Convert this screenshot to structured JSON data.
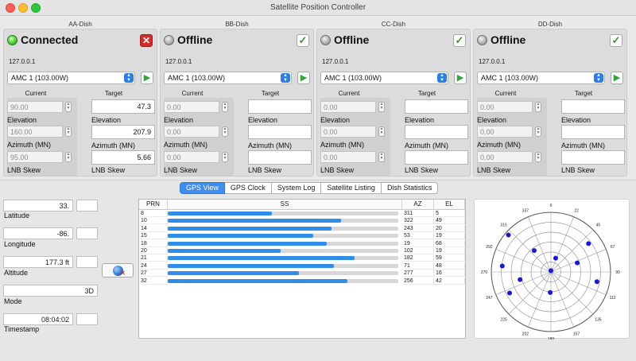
{
  "window": {
    "title": "Satellite Position Controller"
  },
  "dishes": [
    {
      "name": "AA-Dish",
      "status": "Connected",
      "connected": true,
      "ip": "127.0.0.1",
      "satellite": "AMC 1 (103.00W)",
      "current_header": "Current",
      "target_header": "Target",
      "current": {
        "elevation": "90.00",
        "azimuth": "160.00",
        "lnb_skew": "95.00"
      },
      "target": {
        "elevation": "47.3",
        "azimuth": "207.9",
        "lnb_skew": "5.66"
      },
      "labels": {
        "elevation": "Elevation",
        "azimuth": "Azimuth (MN)",
        "lnb_skew": "LNB Skew"
      }
    },
    {
      "name": "BB-Dish",
      "status": "Offline",
      "connected": false,
      "ip": "127.0.0.1",
      "satellite": "AMC 1 (103.00W)",
      "current_header": "Current",
      "target_header": "Target",
      "current": {
        "elevation": "0.00",
        "azimuth": "0.00",
        "lnb_skew": "0.00"
      },
      "target": {
        "elevation": "",
        "azimuth": "",
        "lnb_skew": ""
      },
      "labels": {
        "elevation": "Elevation",
        "azimuth": "Azimuth (MN)",
        "lnb_skew": "LNB Skew"
      }
    },
    {
      "name": "CC-Dish",
      "status": "Offline",
      "connected": false,
      "ip": "127.0.0.1",
      "satellite": "AMC 1 (103.00W)",
      "current_header": "Current",
      "target_header": "Target",
      "current": {
        "elevation": "0.00",
        "azimuth": "0.00",
        "lnb_skew": "0.00"
      },
      "target": {
        "elevation": "",
        "azimuth": "",
        "lnb_skew": ""
      },
      "labels": {
        "elevation": "Elevation",
        "azimuth": "Azimuth (MN)",
        "lnb_skew": "LNB Skew"
      }
    },
    {
      "name": "DD-Dish",
      "status": "Offline",
      "connected": false,
      "ip": "127.0.0.1",
      "satellite": "AMC 1 (103.00W)",
      "current_header": "Current",
      "target_header": "Target",
      "current": {
        "elevation": "0.00",
        "azimuth": "0.00",
        "lnb_skew": "0.00"
      },
      "target": {
        "elevation": "",
        "azimuth": "",
        "lnb_skew": ""
      },
      "labels": {
        "elevation": "Elevation",
        "azimuth": "Azimuth (MN)",
        "lnb_skew": "LNB Skew"
      }
    }
  ],
  "tabs": [
    {
      "label": "GPS View",
      "active": true
    },
    {
      "label": "GPS Clock",
      "active": false
    },
    {
      "label": "System Log",
      "active": false
    },
    {
      "label": "Satellite Listing",
      "active": false
    },
    {
      "label": "Dish Statistics",
      "active": false
    }
  ],
  "gps": {
    "latitude": {
      "value": "33.",
      "label": "Latitude"
    },
    "longitude": {
      "value": "-86.",
      "label": "Longitude"
    },
    "altitude": {
      "value": "177.3 ft",
      "label": "Altitude"
    },
    "mode": {
      "value": "3D",
      "label": "Mode"
    },
    "timestamp": {
      "value": "08:04:02",
      "label": "Timestamp"
    }
  },
  "satellite_table": {
    "headers": {
      "prn": "PRN",
      "ss": "SS",
      "az": "AZ",
      "el": "EL"
    },
    "rows": [
      {
        "prn": "8",
        "ss": 0.45,
        "az": "311",
        "el": "5"
      },
      {
        "prn": "10",
        "ss": 0.75,
        "az": "322",
        "el": "49"
      },
      {
        "prn": "14",
        "ss": 0.71,
        "az": "243",
        "el": "20"
      },
      {
        "prn": "15",
        "ss": 0.63,
        "az": "53",
        "el": "19"
      },
      {
        "prn": "18",
        "ss": 0.69,
        "az": "19",
        "el": "68"
      },
      {
        "prn": "20",
        "ss": 0.49,
        "az": "102",
        "el": "19"
      },
      {
        "prn": "21",
        "ss": 0.81,
        "az": "182",
        "el": "59"
      },
      {
        "prn": "24",
        "ss": 0.72,
        "az": "71",
        "el": "48"
      },
      {
        "prn": "27",
        "ss": 0.57,
        "az": "277",
        "el": "16"
      },
      {
        "prn": "32",
        "ss": 0.78,
        "az": "256",
        "el": "42"
      }
    ]
  },
  "skyplot": {
    "azimuth_labels": [
      "0",
      "22",
      "45",
      "67",
      "90",
      "112",
      "135",
      "157",
      "180",
      "202",
      "225",
      "247",
      "270",
      "292",
      "315",
      "337"
    ],
    "satellites": [
      {
        "az": 0,
        "el": 88
      },
      {
        "az": 311,
        "el": 5
      },
      {
        "az": 322,
        "el": 49
      },
      {
        "az": 243,
        "el": 20
      },
      {
        "az": 53,
        "el": 19
      },
      {
        "az": 19,
        "el": 68
      },
      {
        "az": 102,
        "el": 19
      },
      {
        "az": 182,
        "el": 59
      },
      {
        "az": 71,
        "el": 48
      },
      {
        "az": 277,
        "el": 16
      },
      {
        "az": 256,
        "el": 42
      }
    ],
    "colors": {
      "satellite": "#1717d8",
      "grid": "#555555",
      "ring": "#9a9a9a"
    }
  }
}
